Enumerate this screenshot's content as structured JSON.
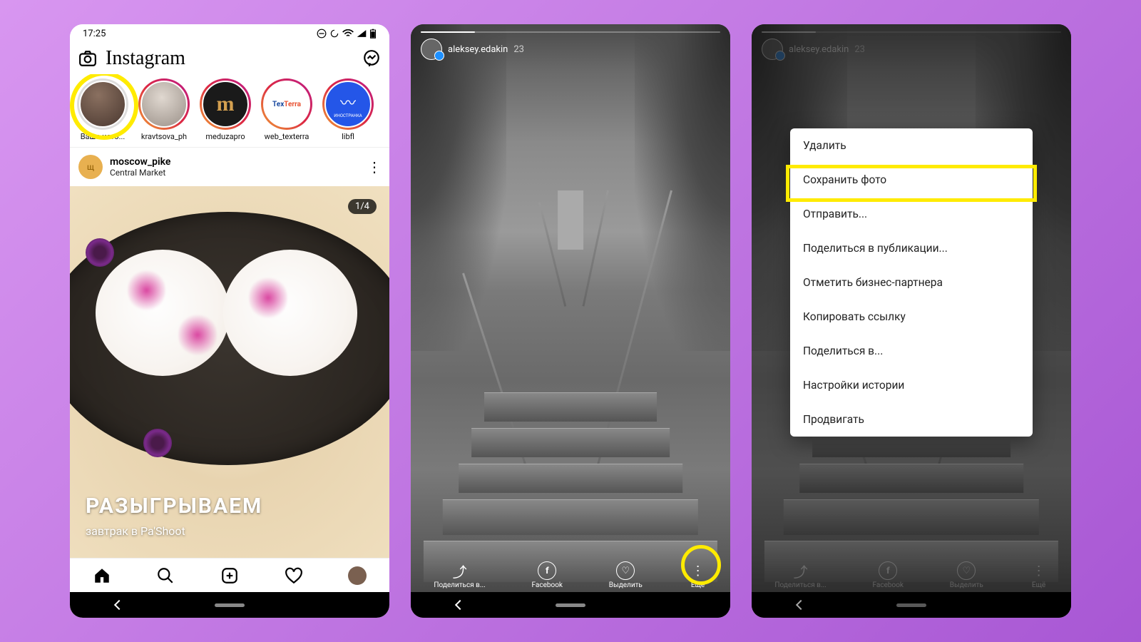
{
  "statusbar": {
    "time": "17:25"
  },
  "header": {
    "logo": "Instagram"
  },
  "stories": [
    {
      "label": "Ваша исто...",
      "bg": "#6a5040"
    },
    {
      "label": "kravtsova_ph",
      "bg": "#c0c0c0"
    },
    {
      "label": "meduzapro",
      "bg": "#1a1a1a",
      "letter": "m",
      "letterColor": "#d4a050"
    },
    {
      "label": "web_texterra",
      "bg": "#fff",
      "text": "TexTerra"
    },
    {
      "label": "libfl",
      "bg": "#2456e8",
      "text": "● ИНОСТРАНКА"
    }
  ],
  "post": {
    "user": "moscow_pike",
    "location": "Central Market",
    "avatar_letter": "щ",
    "badge": "1/4",
    "title": "РАЗЫГРЫВАЕМ",
    "subtitle": "завтрак в Pa'Shoot"
  },
  "story_view": {
    "user": "aleksey.edakin",
    "time": "23",
    "foot": [
      {
        "label": "Поделиться в...",
        "icon": "share"
      },
      {
        "label": "Facebook",
        "icon": "f"
      },
      {
        "label": "Выделить",
        "icon": "♡"
      },
      {
        "label": "Ещё",
        "icon": "⋮"
      }
    ]
  },
  "menu": [
    "Удалить",
    "Сохранить фото",
    "Отправить...",
    "Поделиться в публикации...",
    "Отметить бизнес-партнера",
    "Копировать ссылку",
    "Поделиться в...",
    "Настройки истории",
    "Продвигать"
  ]
}
